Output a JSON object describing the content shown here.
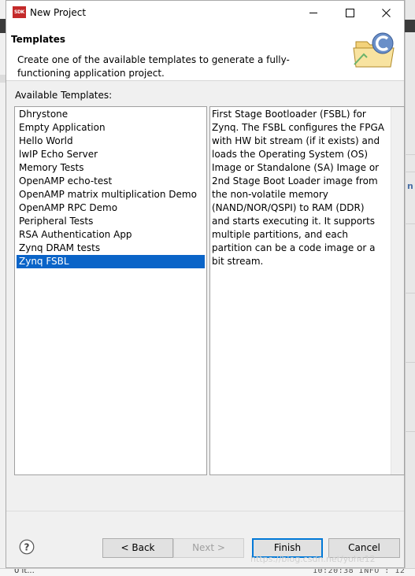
{
  "window": {
    "icon_text": "SDK",
    "title": "New Project"
  },
  "banner": {
    "title": "Templates",
    "description": "Create one of the available templates to generate a fully-functioning application project."
  },
  "templates": {
    "label": "Available Templates:",
    "items": [
      "Dhrystone",
      "Empty Application",
      "Hello World",
      "lwIP Echo Server",
      "Memory Tests",
      "OpenAMP echo-test",
      "OpenAMP matrix multiplication Demo",
      "OpenAMP RPC Demo",
      "Peripheral Tests",
      "RSA Authentication App",
      "Zynq DRAM tests",
      "Zynq FSBL"
    ],
    "selected": "Zynq FSBL",
    "description": "First Stage Bootloader (FSBL) for\nZynq. The FSBL configures the FPGA\nwith HW bit stream (if it exists)  and\nloads the Operating System (OS)\nImage or Standalone (SA) Image or\n2nd Stage Boot Loader image from\nthe  non-volatile memory\n(NAND/NOR/QSPI) to RAM (DDR)\nand starts executing it.  It supports\nmultiple partitions,  and each\npartition can be a code image or a\nbit stream."
  },
  "buttons": {
    "help": "?",
    "back": "< Back",
    "next": "Next >",
    "finish": "Finish",
    "cancel": "Cancel"
  },
  "background": {
    "bottom_left": "0 it...",
    "bottom_right": "10:20:38 INFO  : 12",
    "right_mark": "n"
  },
  "watermark": "https://blog.csdn.net/yohe12",
  "colors": {
    "selection": "#0a64c8",
    "default_button_border": "#0078d7",
    "icon_red": "#c42a2a"
  }
}
